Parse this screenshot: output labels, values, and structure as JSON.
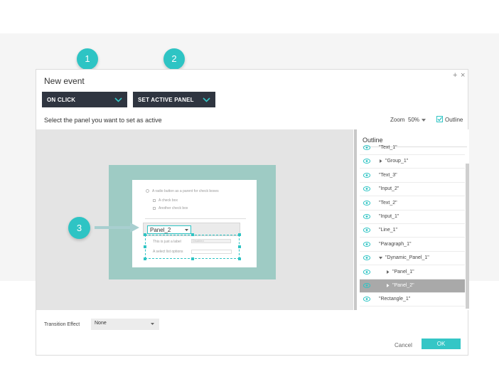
{
  "dialog": {
    "title": "New event"
  },
  "controls": {
    "plus": "+",
    "close": "×"
  },
  "steps": {
    "one": "1",
    "two": "2",
    "three": "3"
  },
  "dropdowns": {
    "trigger": "ON CLICK",
    "action": "SET ACTIVE PANEL"
  },
  "hint": "Select the panel you want to set as active",
  "zoom": {
    "label": "Zoom",
    "value": "50%"
  },
  "outline_toggle": {
    "label": "Outline",
    "checked": true
  },
  "preview": {
    "radio_label": "A radio button as a parent for check boxes",
    "check1": "A check box",
    "check2": "Another check box",
    "panel_select": "Panel_2",
    "label_text": "This is just a label",
    "input_placeholder": "Disabled",
    "list_label": "A select list options"
  },
  "outline": {
    "title": "Outline",
    "items": [
      {
        "label": "\"Text_1\"",
        "level": 0,
        "arrow": "none"
      },
      {
        "label": "\"Group_1\"",
        "level": 0,
        "arrow": "right"
      },
      {
        "label": "\"Text_3\"",
        "level": 0,
        "arrow": "none"
      },
      {
        "label": "\"Input_2\"",
        "level": 0,
        "arrow": "none"
      },
      {
        "label": "\"Text_2\"",
        "level": 0,
        "arrow": "none"
      },
      {
        "label": "\"Input_1\"",
        "level": 0,
        "arrow": "none"
      },
      {
        "label": "\"Line_1\"",
        "level": 0,
        "arrow": "none"
      },
      {
        "label": "\"Paragraph_1\"",
        "level": 0,
        "arrow": "none"
      },
      {
        "label": "\"Dynamic_Panel_1\"",
        "level": 0,
        "arrow": "down"
      },
      {
        "label": "\"Panel_1\"",
        "level": 1,
        "arrow": "right"
      },
      {
        "label": "\"Panel_2\"",
        "level": 1,
        "arrow": "right",
        "selected": true
      },
      {
        "label": "\"Rectangle_1\"",
        "level": 0,
        "arrow": "none"
      }
    ]
  },
  "transition": {
    "label": "Transition Effect",
    "value": "None"
  },
  "buttons": {
    "cancel": "Cancel",
    "ok": "OK"
  },
  "colors": {
    "accent": "#2ec4c4",
    "dark": "#2f3540",
    "mat": "#9ecbc4"
  }
}
